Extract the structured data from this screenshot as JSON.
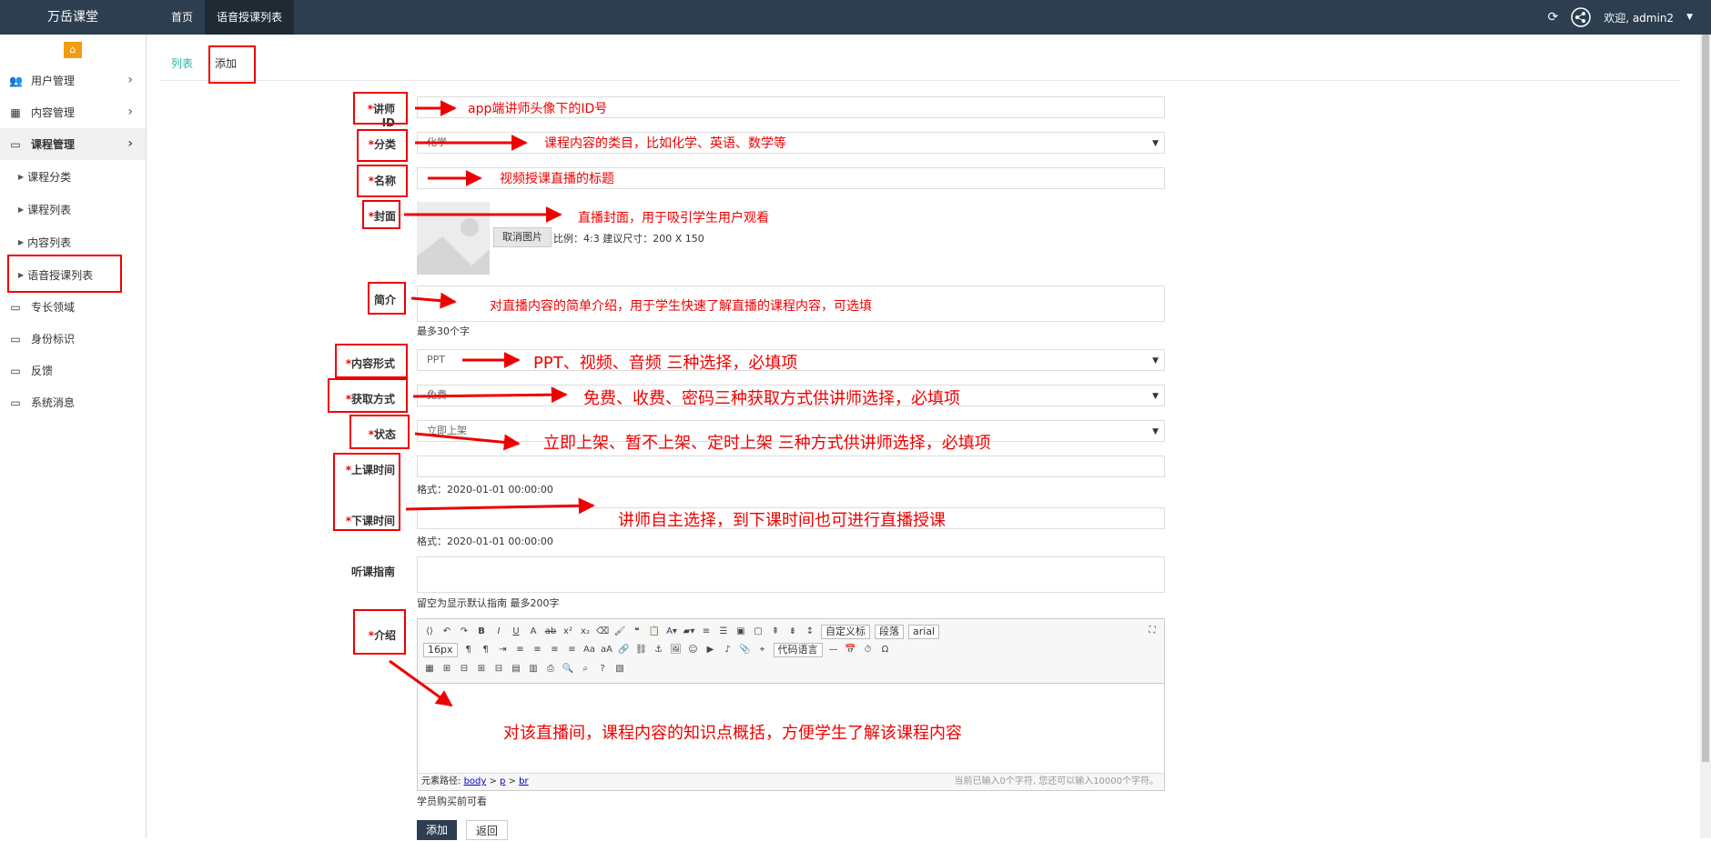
{
  "header": {
    "brand": "万岳课堂",
    "nav": [
      "首页",
      "语音授课列表"
    ],
    "welcome": "欢迎, admin2"
  },
  "sidebar": {
    "items": [
      {
        "label": "用户管理",
        "icon": "users-icon"
      },
      {
        "label": "内容管理",
        "icon": "grid-icon"
      },
      {
        "label": "课程管理",
        "icon": "monitor-icon"
      },
      {
        "label": "专长领域",
        "icon": "monitor-icon"
      },
      {
        "label": "身份标识",
        "icon": "monitor-icon"
      },
      {
        "label": "反馈",
        "icon": "monitor-icon"
      },
      {
        "label": "系统消息",
        "icon": "monitor-icon"
      }
    ],
    "subitems": [
      "课程分类",
      "课程列表",
      "内容列表",
      "语音授课列表"
    ]
  },
  "tabs": [
    "列表",
    "添加"
  ],
  "form": {
    "labels": {
      "teacher_id": "讲师ID",
      "category": "分类",
      "name": "名称",
      "cover": "封面",
      "intro": "简介",
      "content_type": "内容形式",
      "access": "获取方式",
      "status": "状态",
      "start_time": "上课时间",
      "end_time": "下课时间",
      "guide": "听课指南",
      "desc": "介绍"
    },
    "values": {
      "category": "化学",
      "content_type": "PPT",
      "access": "免费",
      "status": "立即上架"
    },
    "cancel_image": "取消图片",
    "ratio_hint": "比例：4:3 建议尺寸：200 X 150",
    "intro_hint": "最多30个字",
    "time_hint_1": "格式：2020-01-01 00:00:00",
    "time_hint_2": "格式：2020-01-01 00:00:00",
    "guide_hint": "留空为显示默认指南 最多200字",
    "desc_hint": "学员购买前可看",
    "editor": {
      "custom_title": "自定义标",
      "paragraph": "段落",
      "font": "arial",
      "size": "16px",
      "code_lang": "代码语言",
      "path_label": "元素路径:",
      "path": [
        "body",
        "p",
        "br"
      ],
      "count": "当前已输入0个字符, 您还可以输入10000个字符。"
    },
    "submit": "添加",
    "back": "返回"
  },
  "annotations": {
    "a1": "app端讲师头像下的ID号",
    "a2": "课程内容的类目，比如化学、英语、数学等",
    "a3": "视频授课直播的标题",
    "a4": "直播封面，用于吸引学生用户观看",
    "a5": "对直播内容的简单介绍，用于学生快速了解直播的课程内容，可选填",
    "a6": "PPT、视频、音频 三种选择，必填项",
    "a7": "免费、收费、密码三种获取方式供讲师选择，必填项",
    "a8": "立即上架、暂不上架、定时上架 三种方式供讲师选择，必填项",
    "a9": "讲师自主选择，到下课时间也可进行直播授课",
    "a10": "对该直播间，课程内容的知识点概括，方便学生了解该课程内容"
  },
  "colors": {
    "topbar": "#2c3e50",
    "accent": "#1abc9c",
    "annotation": "#e00000"
  }
}
